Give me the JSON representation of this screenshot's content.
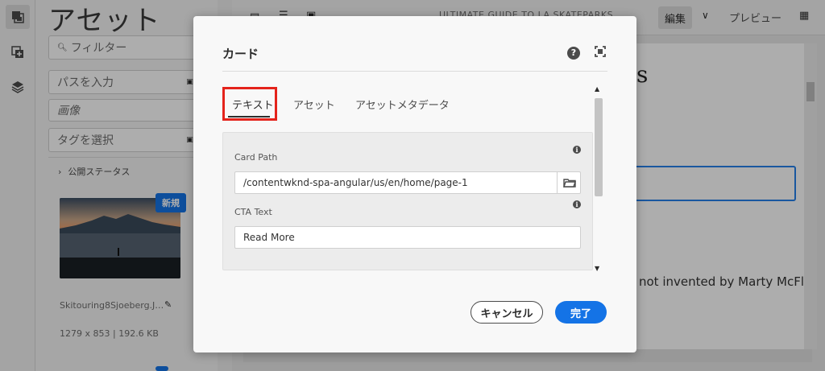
{
  "rail": {
    "icons": [
      "assets-icon",
      "components-icon",
      "layers-icon"
    ]
  },
  "panel": {
    "title": "アセット",
    "filter_placeholder": "フィルター",
    "path_placeholder": "パスを入力",
    "type_select": "画像",
    "tag_placeholder": "タグを選択",
    "status_label": "公開ステータス",
    "asset": {
      "badge": "新規",
      "name": "Skitouring8Sjoeberg.J…",
      "meta": "1279 x 853 | 192.6 KB"
    }
  },
  "editor": {
    "page_title": "ULTIMATE GUIDE TO LA SKATEPARKS",
    "edit_label": "編集",
    "preview_label": "プレビュー",
    "frag1": "s",
    "frag2": "not invented by Marty McFly"
  },
  "dialog": {
    "title": "カード",
    "tabs": [
      "テキスト",
      "アセット",
      "アセットメタデータ"
    ],
    "fields": [
      {
        "label": "Card Path",
        "value": "/contentwknd-spa-angular/us/en/home/page-1"
      },
      {
        "label": "CTA Text",
        "value": "Read More"
      }
    ],
    "cancel_label": "キャンセル",
    "done_label": "完了"
  },
  "colors": {
    "accent": "#1473e6",
    "highlight": "#e4231b"
  }
}
